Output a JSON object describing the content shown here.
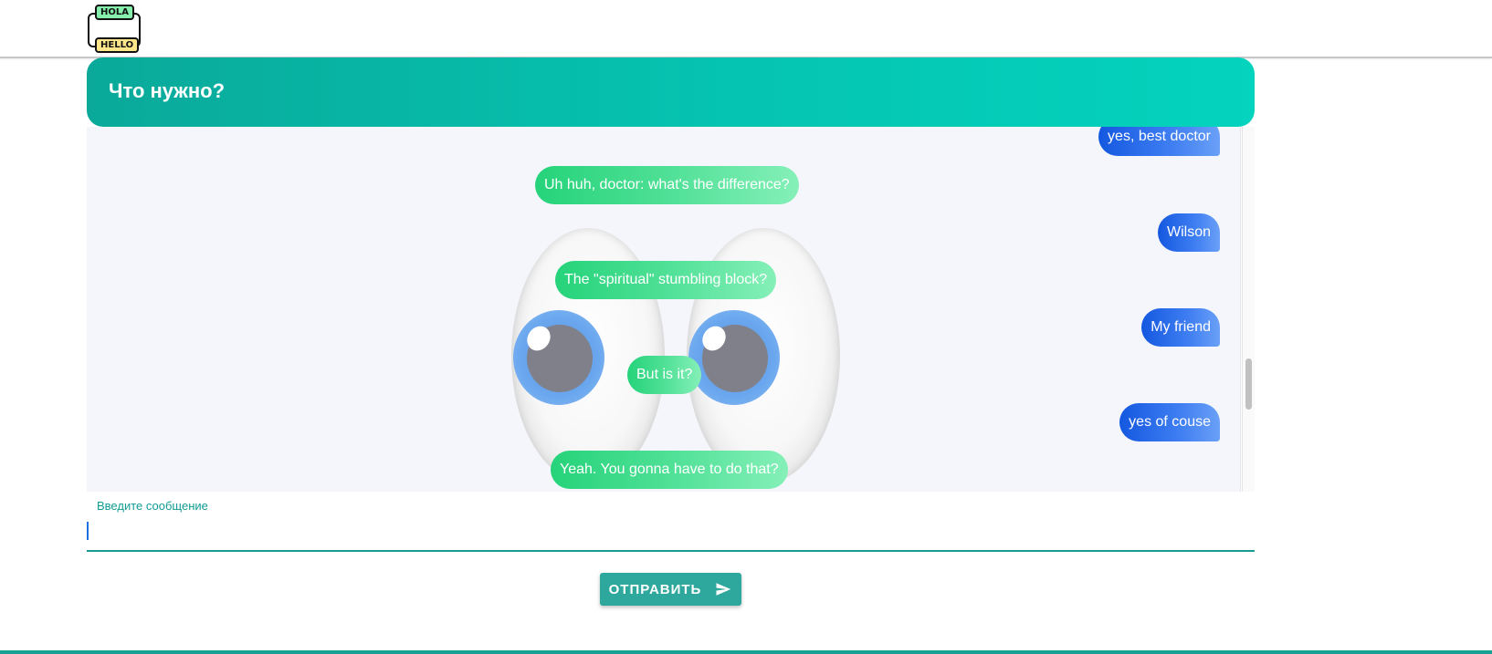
{
  "logo": {
    "top_text": "HOLA",
    "bottom_text": "HELLO"
  },
  "header": {
    "title": "Что нужно?"
  },
  "messages": [
    {
      "from": "user",
      "text": "yes, best doctor"
    },
    {
      "from": "bot",
      "text": "Uh huh, doctor: what's the difference?"
    },
    {
      "from": "user",
      "text": "Wilson"
    },
    {
      "from": "bot",
      "text": "The \"spiritual\" stumbling block?"
    },
    {
      "from": "user",
      "text": "My friend"
    },
    {
      "from": "bot",
      "text": "But is it?"
    },
    {
      "from": "user",
      "text": "yes of couse"
    },
    {
      "from": "bot",
      "text": "Yeah. You gonna have to do that?"
    }
  ],
  "composer": {
    "label": "Введите сообщение",
    "value": "",
    "send_label": "ОТПРАВИТЬ",
    "send_icon": "send-icon"
  },
  "colors": {
    "accent": "#17a294",
    "user_bubble": "#1458e0",
    "bot_bubble": "#25d37a"
  }
}
